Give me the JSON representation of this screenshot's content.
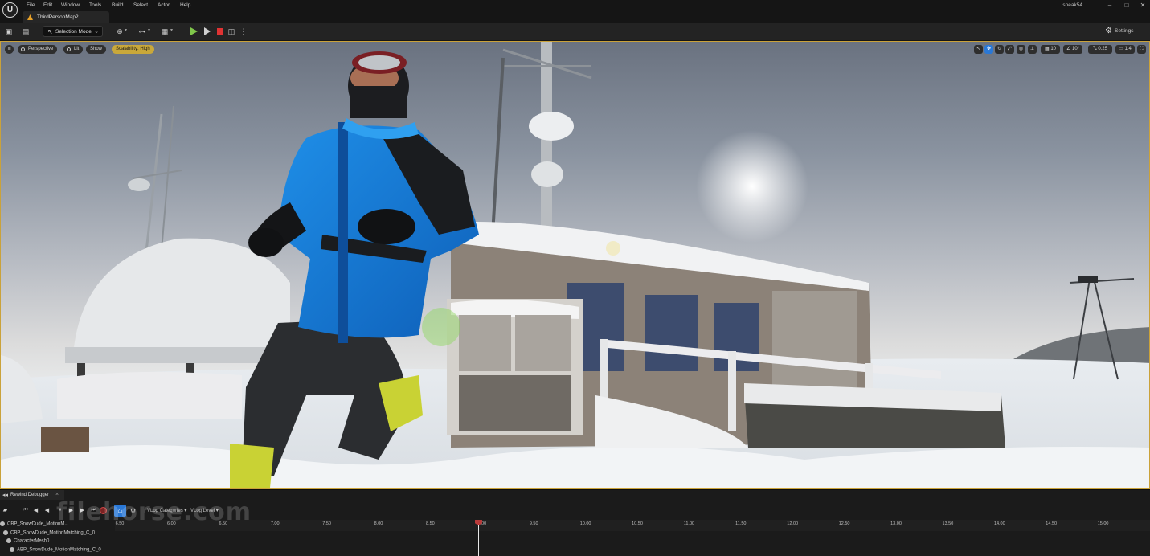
{
  "menu": {
    "items": [
      "File",
      "Edit",
      "Window",
      "Tools",
      "Build",
      "Select",
      "Actor",
      "Help"
    ],
    "user": "sneak54"
  },
  "window_controls": {
    "minimize": "–",
    "maximize": "□",
    "close": "✕"
  },
  "tab": {
    "label": "ThirdPersonMap2"
  },
  "toolbar": {
    "mode_label": "Selection Mode",
    "settings_label": "Settings"
  },
  "viewport": {
    "perspective_label": "Perspective",
    "lit_label": "Lit",
    "show_label": "Show",
    "scalability_label": "Scalability: High",
    "grid_snap_value": "10",
    "rotation_snap_value": "10°",
    "scale_snap_value": "0.25",
    "camera_speed_value": "1.4"
  },
  "rewind": {
    "tab_label": "Rewind Debugger",
    "vlog_categories_label": "VLog Categories",
    "vlog_level_label": "VLog Level",
    "ticks": [
      "6.50",
      "6.00",
      "6.50",
      "7.00",
      "7.50",
      "8.00",
      "8.50",
      "9.00",
      "9.50",
      "10.00",
      "10.50",
      "11.00",
      "11.50",
      "12.00",
      "12.50",
      "13.00",
      "13.50",
      "14.00",
      "14.50",
      "15.00"
    ],
    "tracks": [
      "CBP_SnowDude_MotionM...",
      "CBP_SnowDude_MotionMatching_C_0",
      "CharacterMesh0",
      "ABP_SnowDude_MotionMatching_C_0"
    ]
  },
  "watermark": "filehorse.com",
  "colors": {
    "accent_gold": "#c9a83a",
    "play_green": "#7fc64a",
    "stop_red": "#e03333",
    "follow_blue": "#2a78d6"
  }
}
